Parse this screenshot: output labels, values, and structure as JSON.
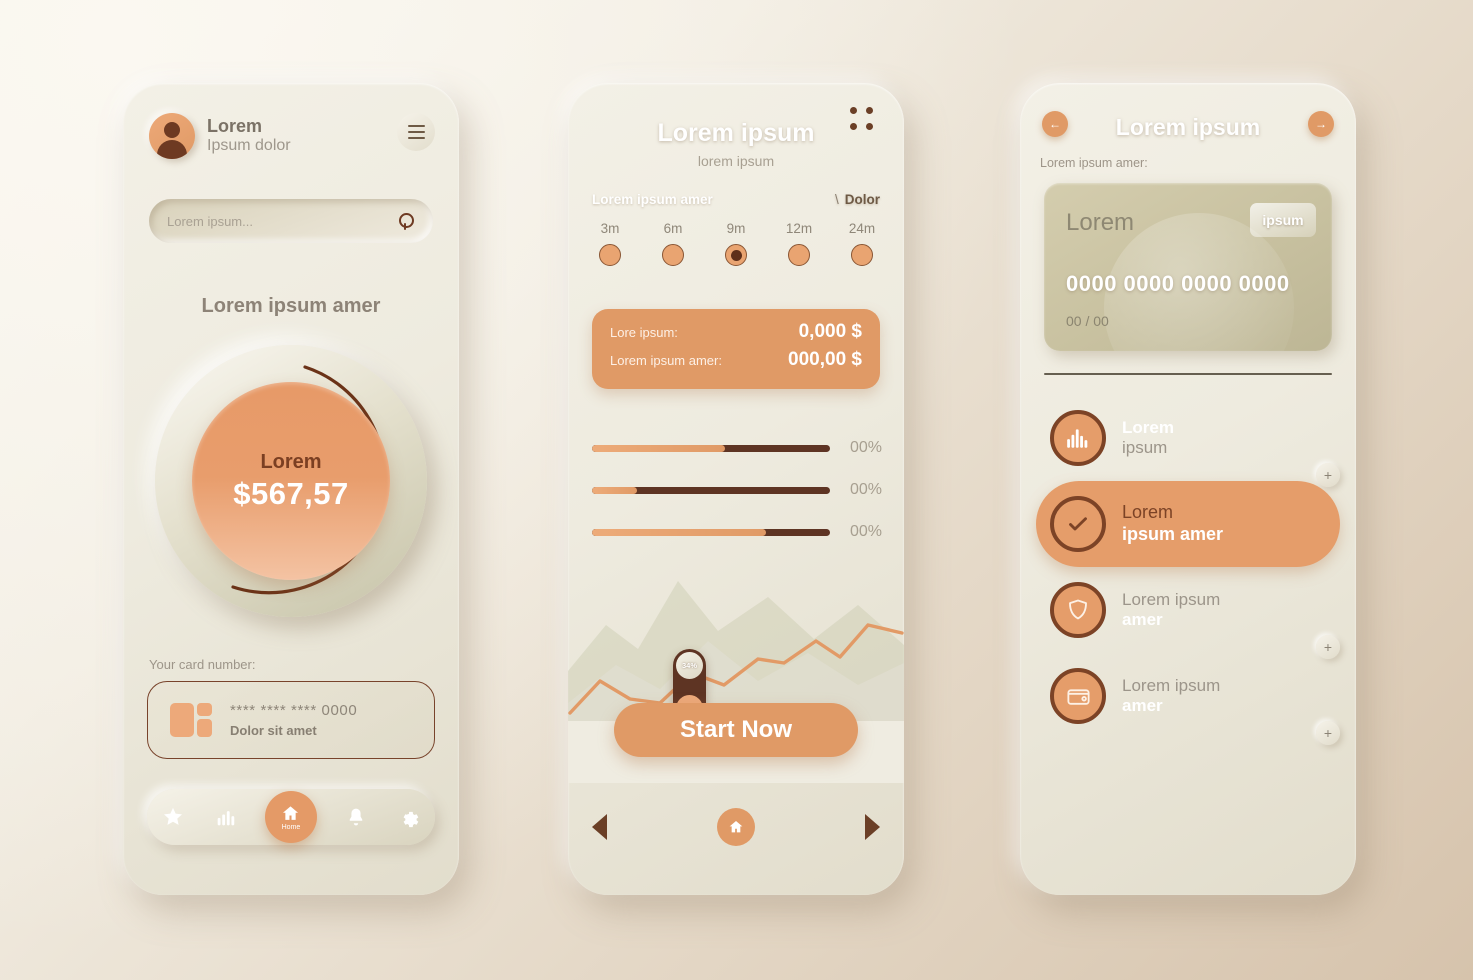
{
  "screen1": {
    "profile": {
      "name": "Lorem",
      "subtitle": "Ipsum dolor",
      "avatar_icon": "user-avatar-icon"
    },
    "menu_icon": "hamburger-menu-icon",
    "search": {
      "placeholder": "Lorem ipsum...",
      "value": "",
      "icon": "search-icon"
    },
    "section_title": "Lorem ipsum amer",
    "gauge": {
      "label": "Lorem",
      "value": "$567,57"
    },
    "card_label": "Your card number:",
    "card": {
      "number": "**** **** **** 0000",
      "holder": "Dolor sit amet",
      "icon": "card-icon"
    },
    "nav": [
      {
        "name": "star-icon",
        "label": ""
      },
      {
        "name": "chart-icon",
        "label": ""
      },
      {
        "name": "home-icon",
        "label": "Home"
      },
      {
        "name": "bell-icon",
        "label": ""
      },
      {
        "name": "gear-icon",
        "label": ""
      }
    ]
  },
  "screen2": {
    "grid_icon": "grid-dots-icon",
    "title": "Lorem ipsum",
    "subtitle": "lorem ipsum",
    "row_label_left": "Lorem ipsum amer",
    "row_label_slash": "\\",
    "row_label_right": "Dolor",
    "ticks": [
      {
        "label": "3m",
        "selected": false
      },
      {
        "label": "6m",
        "selected": false
      },
      {
        "label": "9m",
        "selected": true
      },
      {
        "label": "12m",
        "selected": false
      },
      {
        "label": "24m",
        "selected": false
      }
    ],
    "summary": [
      {
        "key": "Lore ipsum:",
        "value": "0,000 $"
      },
      {
        "key": "Lorem ipsum amer:",
        "value": "000,00 $"
      }
    ],
    "bars": [
      {
        "percent_label": "00%",
        "fill": 56
      },
      {
        "percent_label": "00%",
        "fill": 19
      },
      {
        "percent_label": "00%",
        "fill": 73
      }
    ],
    "toggle": {
      "value": "34%"
    },
    "start_button": "Start Now",
    "footer": {
      "prev_icon": "triangle-left-icon",
      "home_icon": "home-icon",
      "next_icon": "triangle-right-icon"
    }
  },
  "screen3": {
    "back_icon": "arrow-left-icon",
    "forward_icon": "arrow-right-icon",
    "title": "Lorem ipsum",
    "label": "Lorem ipsum amer:",
    "credit_card": {
      "brand": "Lorem",
      "chip_label": "ipsum",
      "number": "0000 0000 0000 0000",
      "expiry": "00 / 00"
    },
    "items": [
      {
        "icon": "bar-chart-icon",
        "line1": "Lorem",
        "line2": "ipsum",
        "selected": false,
        "plus": "+"
      },
      {
        "icon": "check-circle-icon",
        "line1": "Lorem",
        "line2": "ipsum amer",
        "selected": true,
        "plus": ""
      },
      {
        "icon": "shield-icon",
        "line1": "Lorem ipsum",
        "line2": "amer",
        "selected": false,
        "plus": "+"
      },
      {
        "icon": "wallet-icon",
        "line1": "Lorem ipsum",
        "line2": "amer",
        "selected": false,
        "plus": "+"
      }
    ]
  },
  "colors": {
    "accent_orange": "#e09a66",
    "dark_brown": "#5e3423",
    "bg_cream": "#f7f4ec",
    "bg_tan": "#d6c3ac",
    "panel": "#eeebdf"
  }
}
